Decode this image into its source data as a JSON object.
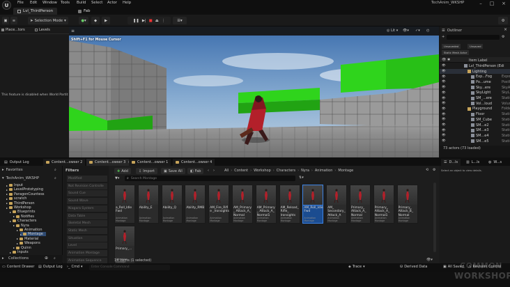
{
  "window": {
    "app_title": "TechAnim_WKSHP"
  },
  "menu": [
    "File",
    "Edit",
    "Window",
    "Tools",
    "Build",
    "Select",
    "Actor",
    "Help"
  ],
  "tabs": {
    "level": "Lvl_ThirdPerson",
    "fab": "Fab"
  },
  "toolbar": {
    "mode": "Selection Mode"
  },
  "left_panel": {
    "tab_place": "Place...tors",
    "tab_levels": "Levels",
    "message": "This feature is disabled when World Partit"
  },
  "viewport": {
    "hint": "Shift+F1 for Mouse Cursor",
    "lit": "Lit"
  },
  "outliner": {
    "title": "Outliner",
    "filters": [
      "Unsaveded",
      "Unsaved",
      "Static Mesh Actor"
    ],
    "column_label": "Item Label",
    "rows": [
      {
        "name": "Lvl_ThirdPerson (Edi",
        "type": "",
        "indent": 0
      },
      {
        "name": "Lighting",
        "type": "",
        "indent": 1,
        "folder": true,
        "highlight": true
      },
      {
        "name": "Exp...Fog",
        "type": "Expone",
        "indent": 2
      },
      {
        "name": "Po...ume",
        "type": "PostPr",
        "indent": 2
      },
      {
        "name": "Sky...ere",
        "type": "SkyAtn",
        "indent": 2
      },
      {
        "name": "SkyLight",
        "type": "SkyLig",
        "indent": 2
      },
      {
        "name": "SM_...ere",
        "type": "StaticM",
        "indent": 2
      },
      {
        "name": "Vol...loud",
        "type": "Volume",
        "indent": 2
      },
      {
        "name": "Playground",
        "type": "Folder",
        "indent": 1,
        "folder": true
      },
      {
        "name": "Floor",
        "type": "StaticM",
        "indent": 2
      },
      {
        "name": "SM_Cube",
        "type": "StaticM",
        "indent": 2
      },
      {
        "name": "SM...e2",
        "type": "StaticM",
        "indent": 2
      },
      {
        "name": "SM...e3",
        "type": "StaticM",
        "indent": 2
      },
      {
        "name": "SM...e4",
        "type": "StaticM",
        "indent": 2
      },
      {
        "name": "SM...e5",
        "type": "StaticM",
        "indent": 2
      }
    ],
    "footer": "73 actors (73 loaded)"
  },
  "bottom_tabs": [
    "Output Log",
    "Content...owser 2",
    "Content...owser 3",
    "Content...owser 1",
    "Content...owser 4"
  ],
  "details_tabs": [
    "D...ls",
    "L...ls",
    "W...s"
  ],
  "details_message": "Select an object to view details.",
  "content_browser": {
    "favorites": "Favorites",
    "project": "TechAnim_WKSHP",
    "collections": "Collections",
    "filters_title": "Filters",
    "add": "Add",
    "import": "Import",
    "save_all": "Save All",
    "fab": "Fab",
    "search_placeholder": "Search Montage",
    "search_folders_placeholder": "Search Folders",
    "breadcrumb": [
      "All",
      "Content",
      "Workshop",
      "Characters",
      "Nyra",
      "Animation",
      "Montage"
    ],
    "tree": [
      {
        "label": "Input",
        "indent": 1
      },
      {
        "label": "LevelPrototyping",
        "indent": 1
      },
      {
        "label": "ParagonCountess",
        "indent": 1
      },
      {
        "label": "scratch",
        "indent": 1
      },
      {
        "label": "ThirdPerson",
        "indent": 1
      },
      {
        "label": "Workshop",
        "indent": 1
      },
      {
        "label": "Blueprints",
        "indent": 2
      },
      {
        "label": "Notifies",
        "indent": 3
      },
      {
        "label": "Characters",
        "indent": 2
      },
      {
        "label": "Nyra",
        "indent": 3
      },
      {
        "label": "Animation",
        "indent": 4
      },
      {
        "label": "Montage",
        "indent": 5,
        "selected": true
      },
      {
        "label": "Material",
        "indent": 4
      },
      {
        "label": "Weapons",
        "indent": 4
      },
      {
        "label": "Quinn",
        "indent": 3
      },
      {
        "label": "Inputs",
        "indent": 2
      }
    ],
    "filter_items": [
      "Modified",
      "Not Revision Controlle",
      "Sound Cue",
      "Sound Wave",
      "Niagara System",
      "Data Table",
      "Skeletal Mesh",
      "Static Mesh",
      "Situation",
      "Level",
      "Animation Montage",
      "Animation Sequence"
    ],
    "assets": [
      {
        "label": "a_Roll_Idle Fwd",
        "type": "Animation Montage"
      },
      {
        "label": "Ability_E",
        "type": "Animation Montage"
      },
      {
        "label": "Ability_Q",
        "type": "Animation Montage"
      },
      {
        "label": "Ability_RMB",
        "type": "Animation Montage"
      },
      {
        "label": "AM_Fire_Rifle _Ironsights",
        "type": "Animation Montage"
      },
      {
        "label": "AM_Primary_ Attack_A_ Normal",
        "type": "Animation Montage"
      },
      {
        "label": "AM_Primary_ Attack_A_ Normal1",
        "type": "Animation Montage"
      },
      {
        "label": "AM_Reload_ Rifle_ Ironsights",
        "type": "Animation Montage"
      },
      {
        "label": "AM_Roll_Idle Fwd",
        "type": "Animation Montage",
        "selected": true
      },
      {
        "label": "AM_ Secondary_ Attack_A",
        "type": "Animation Montage"
      },
      {
        "label": "Primary_ Attack_A_ Normal",
        "type": "Animation Montage"
      },
      {
        "label": "Primary_ Attack_A_ Normal1",
        "type": "Animation Montage"
      },
      {
        "label": "Primary_ Attack_B_ Normal",
        "type": "Animation Montage"
      },
      {
        "label": "Primary_...",
        "type": "Animation Montage"
      }
    ],
    "status": "14 items (1 selected)"
  },
  "statusbar": {
    "content_drawer": "Content Drawer",
    "output_log": "Output Log",
    "cmd": "Cmd",
    "console_placeholder": "Enter Console Command",
    "trace": "Trace",
    "derived": "Derived Data",
    "all_saved": "All Saved",
    "revision": "Revision Control"
  },
  "watermark": [
    "COMMON",
    "WORKSHOP"
  ],
  "colors": {
    "accent": "#3d84e6",
    "folder": "#c7a45a",
    "green_block": "#2fd41c",
    "selection": "#1b4c90"
  }
}
